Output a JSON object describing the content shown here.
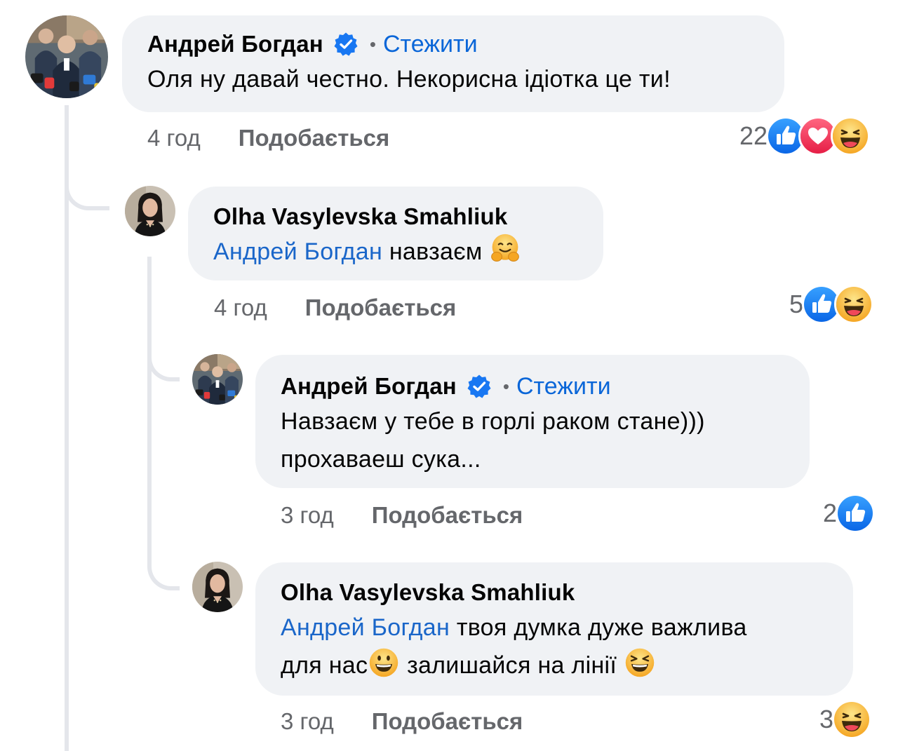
{
  "comments": [
    {
      "author": "Андрей Богдан",
      "verified": true,
      "follow_label": "Стежити",
      "text": "Оля ну давай честно. Некорисна ідіотка це ти!",
      "time": "4 год",
      "like_label": "Подобається",
      "reaction_count": "22",
      "reactions": [
        "like-icon",
        "love-icon",
        "haha-icon"
      ]
    },
    {
      "author": "Olha Vasylevska Smahliuk",
      "mention": "Андрей Богдан",
      "text": " навзаєм ",
      "emoji": "hugging-emoji",
      "time": "4 год",
      "like_label": "Подобається",
      "reaction_count": "5",
      "reactions": [
        "like-icon",
        "haha-icon"
      ]
    },
    {
      "author": "Андрей Богдан",
      "verified": true,
      "follow_label": "Стежити",
      "text_line1": "Навзаєм у тебе в горлі раком стане)))",
      "text_line2": "прохаваеш сука...",
      "time": "3 год",
      "like_label": "Подобається",
      "reaction_count": "2",
      "reactions": [
        "like-icon"
      ]
    },
    {
      "author": "Olha Vasylevska Smahliuk",
      "mention": "Андрей Богдан",
      "text_line1": " твоя думка дуже важлива",
      "text_line2a": "для нас",
      "text_line2b": " залишайся на лінії ",
      "emojis": [
        "grinning-emoji",
        "laughing-emoji"
      ],
      "time": "3 год",
      "like_label": "Подобається",
      "reaction_count": "3",
      "reactions": [
        "haha-icon"
      ]
    }
  ],
  "colors": {
    "bubble": "#f0f2f5",
    "link": "#1a66c9",
    "meta": "#65676b",
    "like": "#1877f2",
    "love": "#f33e58",
    "haha": "#f7b125"
  }
}
